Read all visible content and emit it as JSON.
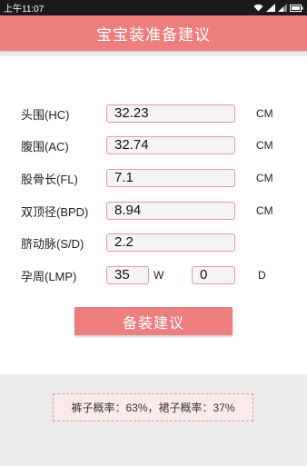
{
  "status_bar": {
    "time": "上午11:07",
    "icons": [
      "wifi-icon",
      "signal-icon",
      "signal-icon",
      "battery-icon"
    ]
  },
  "header": {
    "title": "宝宝装准备建议"
  },
  "form": {
    "hc": {
      "label": "头围(HC)",
      "value": "32.23",
      "unit": "CM"
    },
    "ac": {
      "label": "腹围(AC)",
      "value": "32.74",
      "unit": "CM"
    },
    "fl": {
      "label": "股骨长(FL)",
      "value": "7.1",
      "unit": "CM"
    },
    "bpd": {
      "label": "双顶径(BPD)",
      "value": "8.94",
      "unit": "CM"
    },
    "sd": {
      "label": "脐动脉(S/D)",
      "value": "2.2"
    },
    "lmp": {
      "label": "孕周(LMP)",
      "weeks_value": "35",
      "weeks_unit": "W",
      "days_value": "0",
      "days_unit": "D"
    }
  },
  "button": {
    "label": "备装建议"
  },
  "result": {
    "text": "裤子概率：63%，裙子概率：37%"
  },
  "colors": {
    "accent": "#ec7e7e",
    "field_border": "#e59a9a",
    "result_bg": "#fbeaea"
  }
}
